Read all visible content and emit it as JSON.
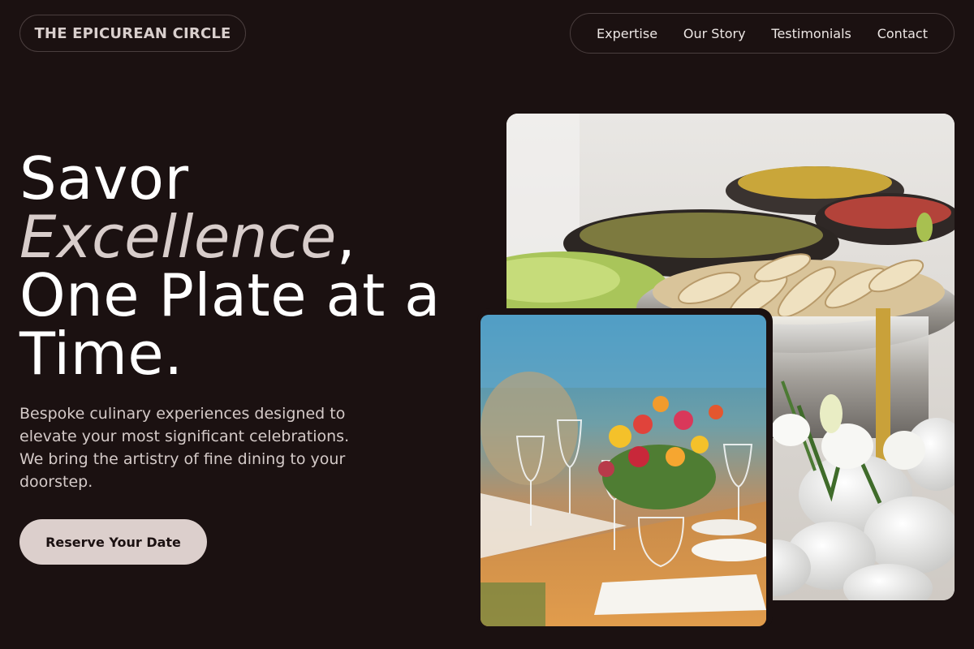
{
  "brand": {
    "name": "THE EPICUREAN CIRCLE"
  },
  "nav": {
    "items": [
      {
        "label": "Expertise"
      },
      {
        "label": "Our Story"
      },
      {
        "label": "Testimonials"
      },
      {
        "label": "Contact"
      }
    ]
  },
  "hero": {
    "line1": "Savor",
    "line2_em": "Excellence",
    "line2_rest": ",",
    "line3": "One Plate at a",
    "line4": "Time.",
    "subtitle": "Bespoke culinary experiences designed to elevate your most significant celebrations. We bring the artistry of fine dining to your doorstep.",
    "cta_label": "Reserve Your Date"
  },
  "theme": {
    "background": "#1b1111",
    "accent": "#dccfcc",
    "border": "#4a3e3e"
  }
}
